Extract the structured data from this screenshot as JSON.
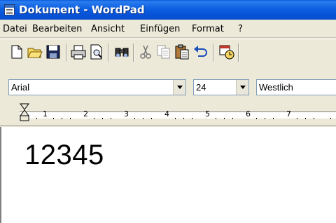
{
  "window": {
    "title": "Dokument - WordPad"
  },
  "menu": {
    "items": [
      "Datei",
      "Bearbeiten",
      "Ansicht",
      "Einfügen",
      "Format",
      "?"
    ]
  },
  "toolbar": {
    "buttons": [
      "new-icon",
      "open-icon",
      "save-icon",
      "print-icon",
      "print-preview-icon",
      "find-icon",
      "cut-icon",
      "copy-icon",
      "paste-icon",
      "undo-icon",
      "date-time-icon"
    ]
  },
  "format_bar": {
    "font": "Arial",
    "size": "24",
    "script": "Westlich"
  },
  "ruler": {
    "numbers": [
      "1",
      "2",
      "3",
      "4",
      "5",
      "6",
      "7"
    ]
  },
  "document": {
    "text": "12345"
  },
  "colors": {
    "title_bar": "#0a5ad8",
    "chrome": "#ece9d8",
    "document_bg": "#ffffff"
  }
}
